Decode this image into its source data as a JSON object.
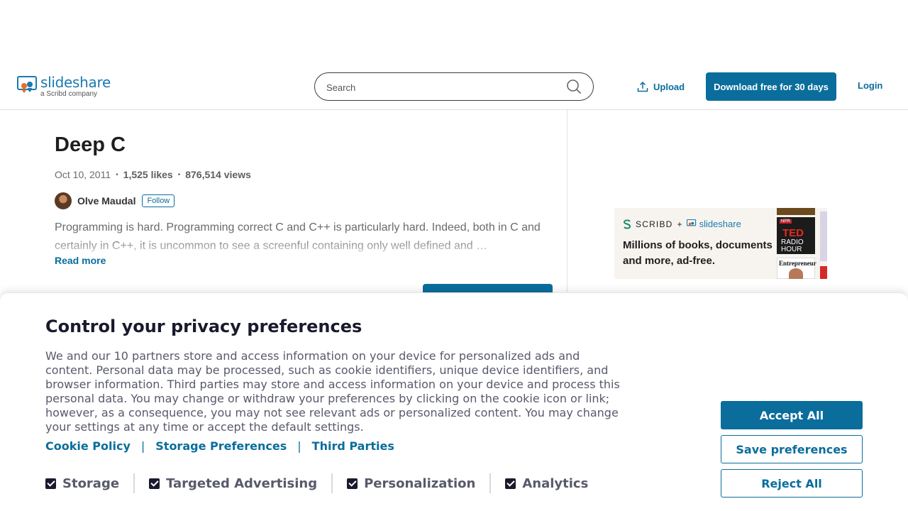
{
  "header": {
    "logo_name": "slideshare",
    "logo_sub": "a Scribd company",
    "search_placeholder": "Search",
    "upload_label": "Upload",
    "download_label": "Download free for 30 days",
    "login_label": "Login"
  },
  "doc": {
    "title": "Deep C",
    "date": "Oct 10, 2011",
    "likes": "1,525 likes",
    "views": "876,514 views",
    "author": "Olve Maudal",
    "follow_label": "Follow",
    "description": "Programming is hard. Programming correct C and C++ is particularly hard. Indeed, both in C and certainly in C++, it is uncommon to see a screenful containing only well defined and …",
    "read_more": "Read more"
  },
  "ad": {
    "brand_scribd": "SCRIBD",
    "plus": "+",
    "brand_slideshare": "slideshare",
    "line1": "Millions of books, documents",
    "line2": "and more, ad-free.",
    "book_npr": "NPR",
    "book_ted": "TED",
    "book_radio": "RADIO",
    "book_hour": "HOUR",
    "book_ent": "Entrepreneur"
  },
  "privacy": {
    "title": "Control your privacy preferences",
    "body": "We and our 10 partners store and access information on your device for personalized ads and content. Personal data may be processed, such as cookie identifiers, unique device identifiers, and browser information. Third parties may store and access information on your device and process this personal data. You may change or withdraw your preferences by clicking on the cookie icon or link; however, as a consequence, you may not see relevant ads or personalized content. You may change your settings at any time or accept the default settings.",
    "links": [
      "Cookie Policy",
      "Storage Preferences",
      "Third Parties"
    ],
    "link_separator": "|",
    "checks": [
      "Storage",
      "Targeted Advertising",
      "Personalization",
      "Analytics"
    ],
    "accept_label": "Accept All",
    "save_label": "Save preferences",
    "reject_label": "Reject All"
  },
  "colors": {
    "brand_blue": "#0a6d9c",
    "dark": "#1a1a2e"
  }
}
